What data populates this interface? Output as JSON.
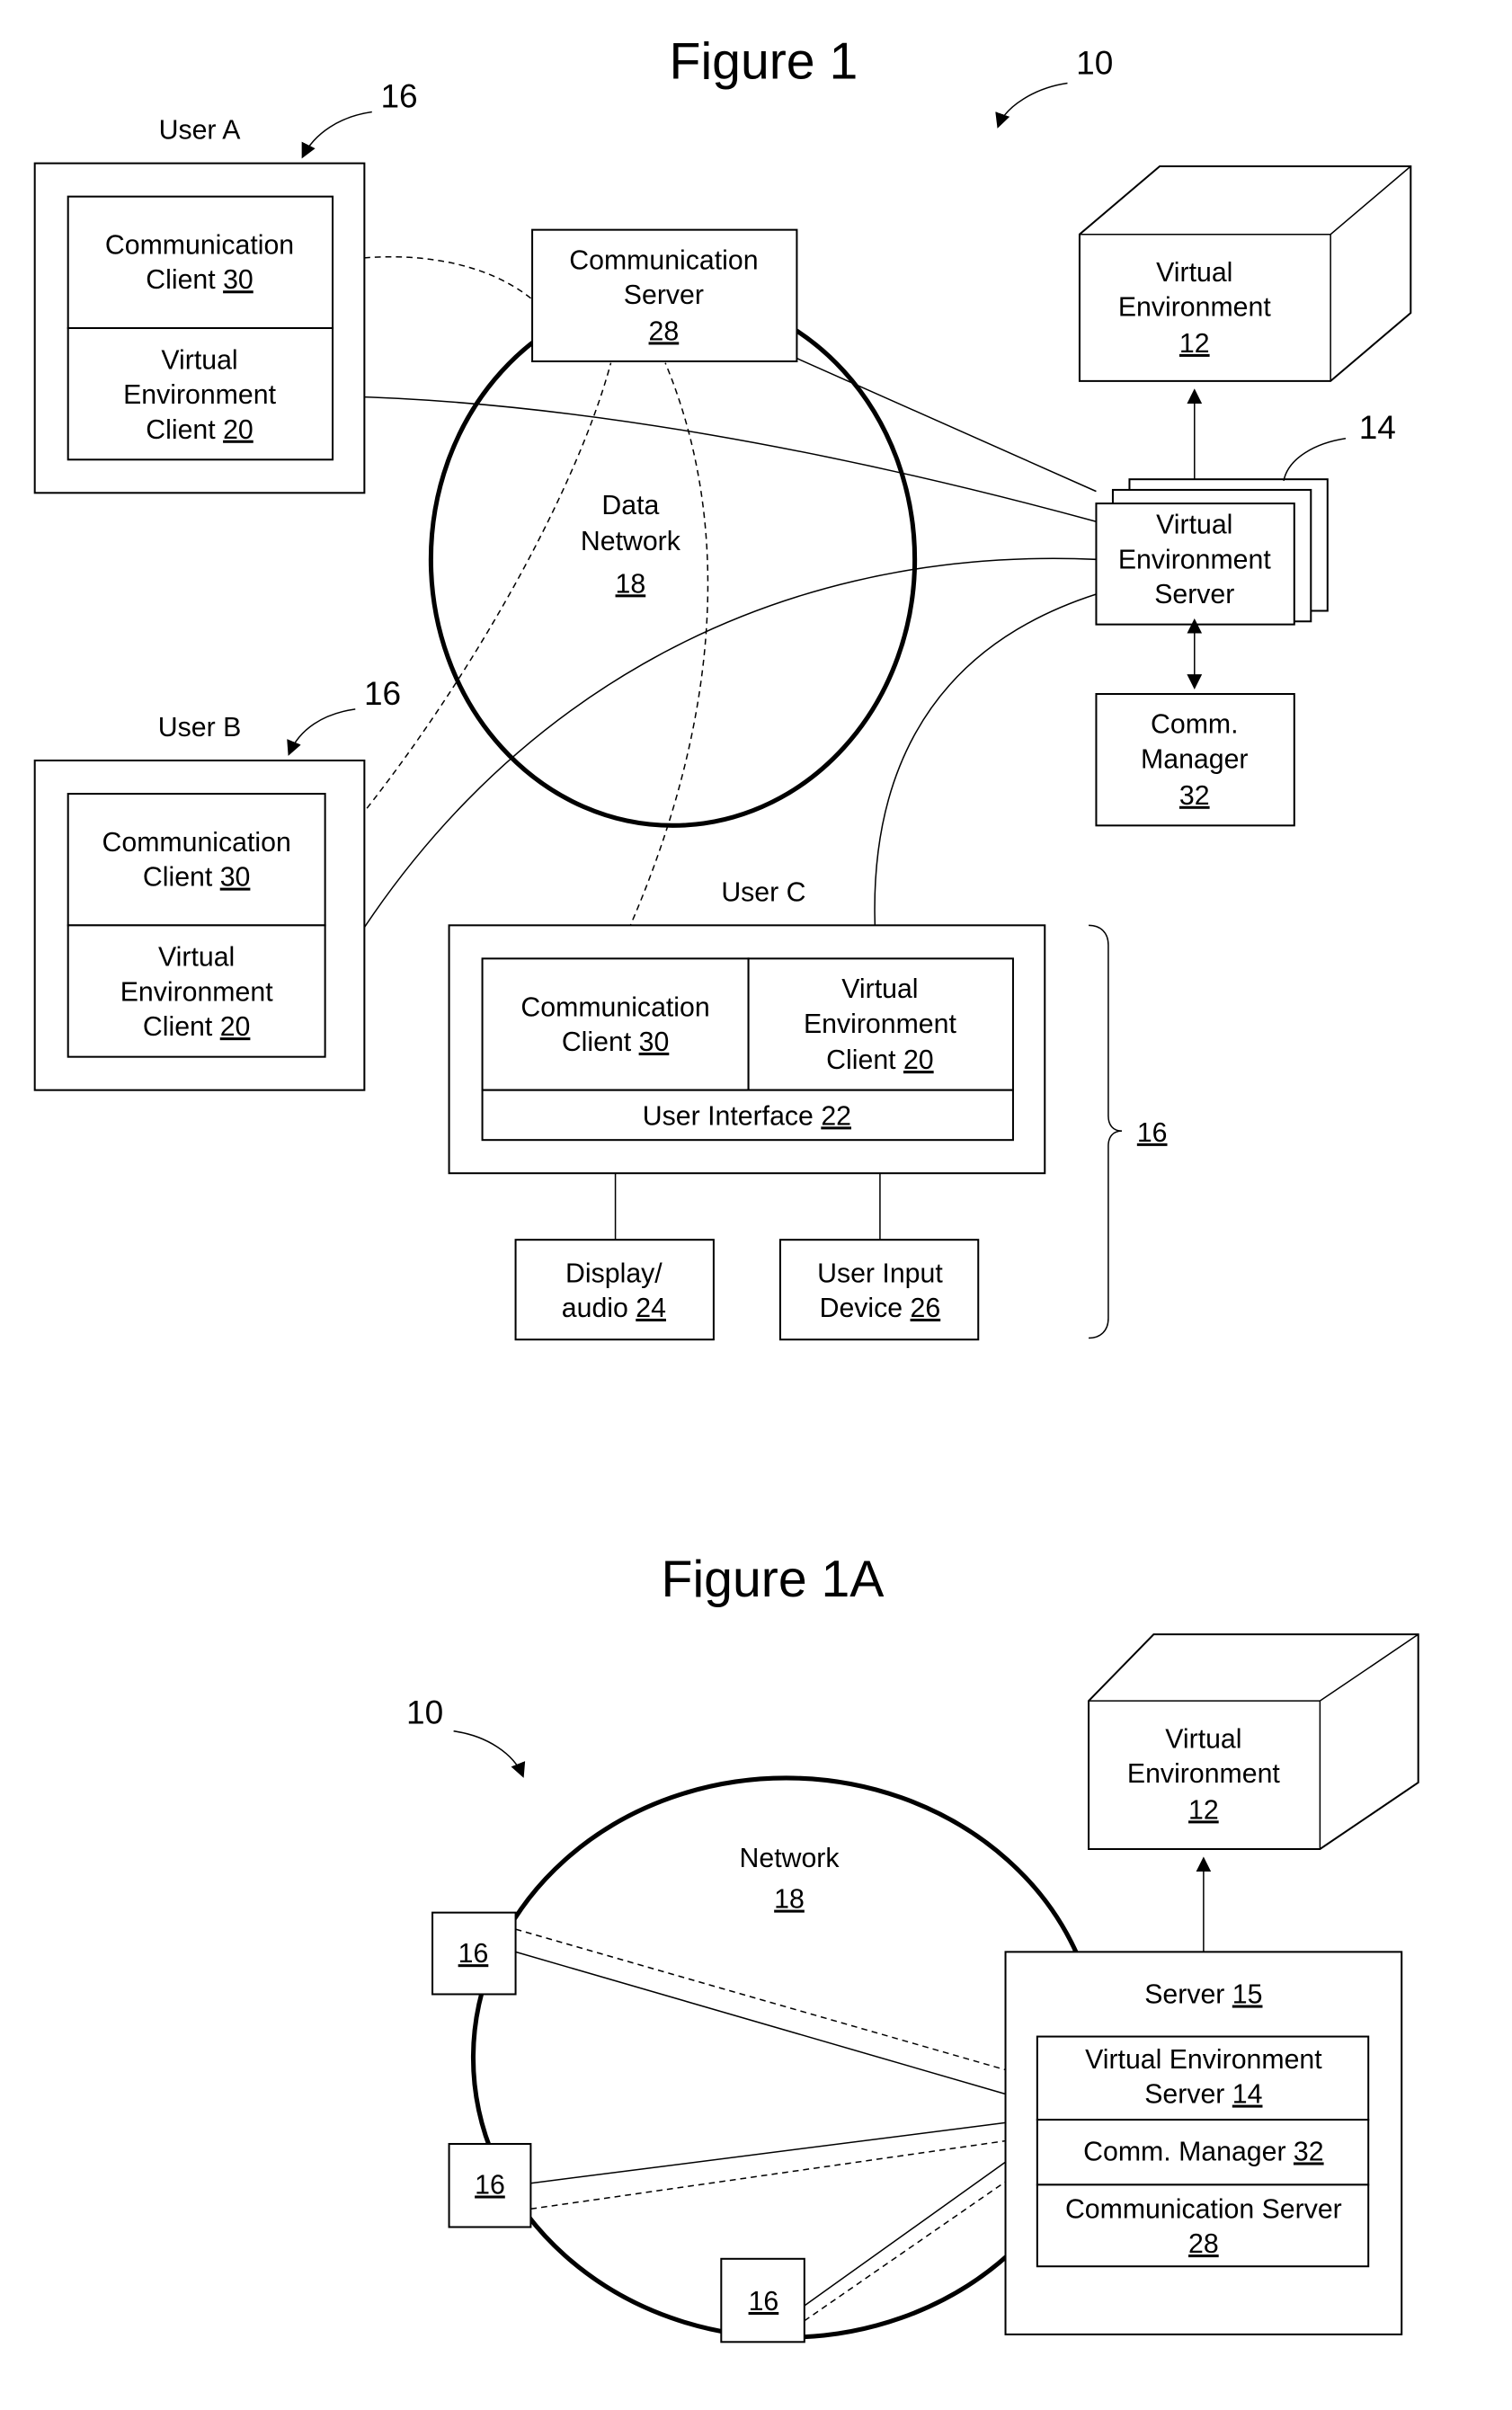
{
  "figure1": {
    "title": "Figure 1",
    "ref_system": "10",
    "ref_users": "16",
    "user_a": {
      "label": "User A",
      "comm_client": [
        "Communication",
        "Client ",
        "30"
      ],
      "ve_client": [
        "Virtual",
        "Environment",
        "Client ",
        "20"
      ]
    },
    "user_b": {
      "label": "User B",
      "comm_client": [
        "Communication",
        "Client ",
        "30"
      ],
      "ve_client": [
        "Virtual",
        "Environment",
        "Client ",
        "20"
      ]
    },
    "user_c": {
      "label": "User C",
      "comm_client": [
        "Communication",
        "Client ",
        "30"
      ],
      "ve_client": [
        "Virtual",
        "Environment",
        "Client ",
        "20"
      ],
      "user_interface": [
        "User Interface ",
        "22"
      ],
      "display": [
        "Display/",
        "audio ",
        "24"
      ],
      "input": [
        "User Input",
        "Device ",
        "26"
      ],
      "brace_ref": "16"
    },
    "comm_server": [
      "Communication",
      "Server",
      "28"
    ],
    "network": [
      "Data",
      "Network",
      "18"
    ],
    "virtual_env": [
      "Virtual",
      "Environment",
      "12"
    ],
    "ve_server": [
      "Virtual",
      "Environment",
      "Server"
    ],
    "ve_server_ref": "14",
    "comm_manager": [
      "Comm.",
      "Manager",
      "32"
    ]
  },
  "figure1a": {
    "title": "Figure 1A",
    "ref_system": "10",
    "network": [
      "Network",
      "18"
    ],
    "virtual_env": [
      "Virtual",
      "Environment",
      "12"
    ],
    "server": [
      "Server ",
      "15"
    ],
    "ve_server": [
      "Virtual Environment",
      "Server ",
      "14"
    ],
    "comm_manager": [
      "Comm. Manager ",
      "32"
    ],
    "comm_server": [
      "Communication Server",
      "28"
    ],
    "user_nodes": [
      "16",
      "16",
      "16"
    ]
  }
}
